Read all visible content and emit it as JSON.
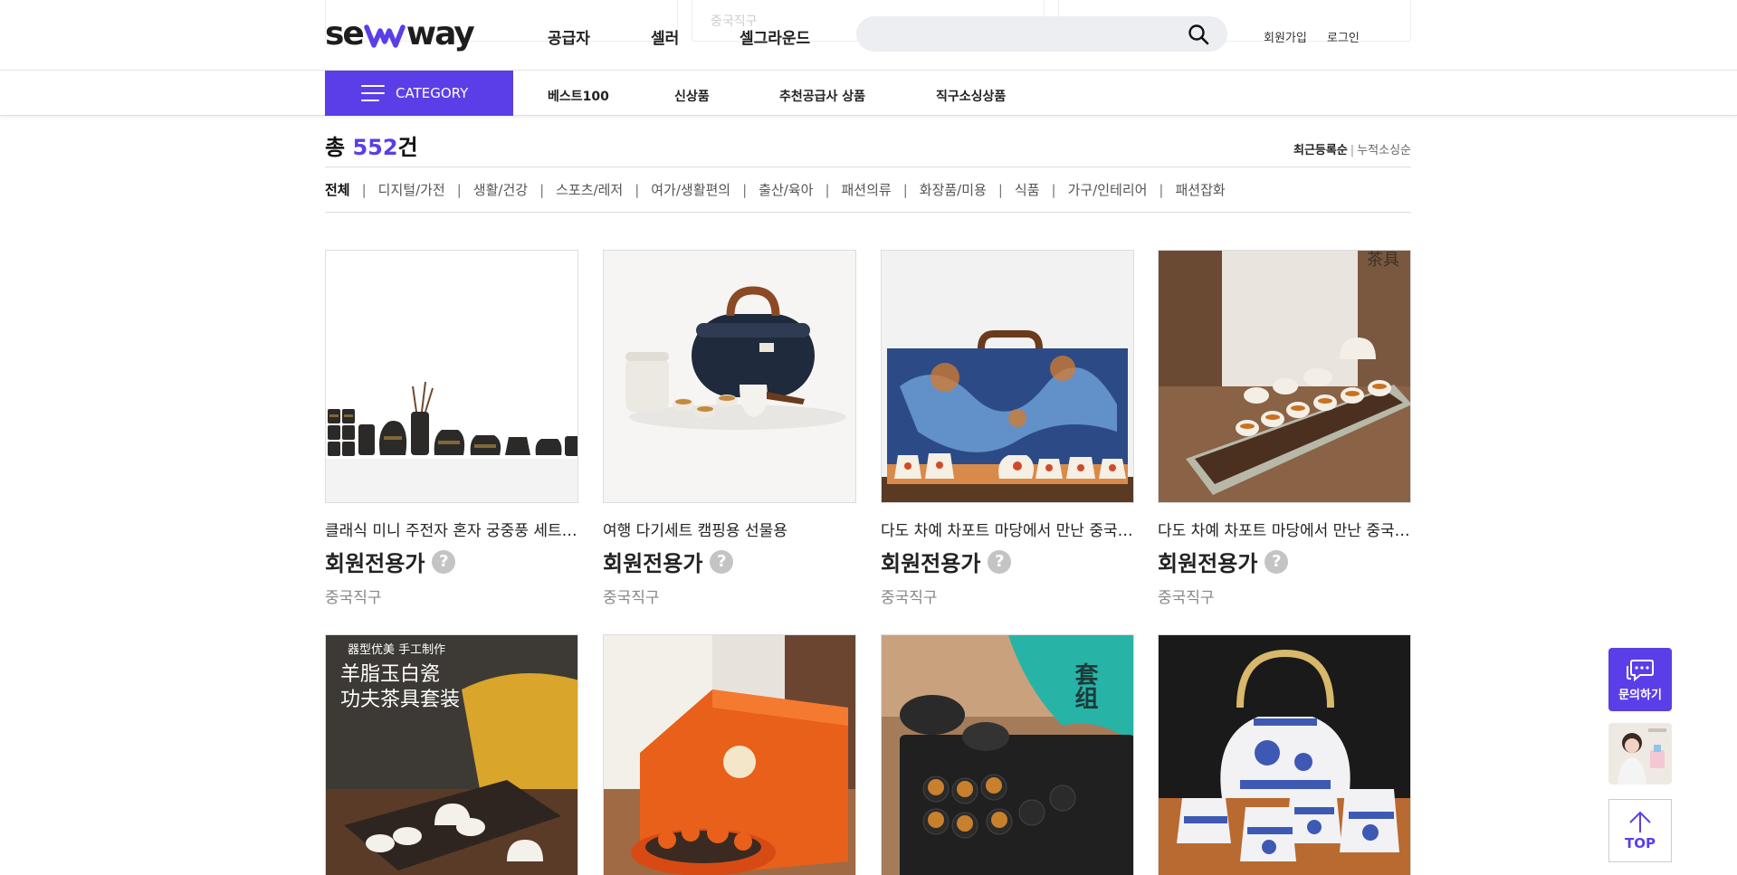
{
  "header": {
    "logo": {
      "pre": "se",
      "post": "way"
    },
    "nav": [
      "공급자",
      "셀러",
      "셀그라운드"
    ],
    "search": {
      "placeholder": ""
    },
    "util": [
      "회원가입",
      "로그인"
    ],
    "ghost_texts": [
      "중국직구"
    ]
  },
  "category_bar": {
    "button_label": "CATEGORY",
    "links": [
      "베스트100",
      "신상품",
      "추천공급사 상품",
      "직구소싱상품"
    ]
  },
  "results": {
    "total_prefix": "총 ",
    "total_count": "552",
    "total_suffix": "건",
    "sort": {
      "active": "최근등록순",
      "other": "누적소싱순"
    },
    "tabs": [
      "전체",
      "디지털/가전",
      "생활/건강",
      "스포츠/레저",
      "여가/생활편의",
      "출산/육아",
      "패션의류",
      "화장품/미용",
      "식품",
      "가구/인테리어",
      "패션잡화"
    ],
    "active_tab": 0
  },
  "products": [
    {
      "name": "클래식 미니 주전자 혼자 궁중풍 세트 가정용",
      "price": "회원전용가",
      "origin": "중국직구"
    },
    {
      "name": "여행 다기세트 캠핑용 선물용",
      "price": "회원전용가",
      "origin": "중국직구"
    },
    {
      "name": "다도 차예 차포트 마당에서 만난 중국식 다기세트",
      "price": "회원전용가",
      "origin": "중국직구"
    },
    {
      "name": "다도 차예 차포트 마당에서 만난 중국식 다기세트",
      "price": "회원전용가",
      "origin": "중국직구"
    },
    {
      "name": "",
      "price": "",
      "origin": ""
    },
    {
      "name": "",
      "price": "",
      "origin": ""
    },
    {
      "name": "",
      "price": "",
      "origin": ""
    },
    {
      "name": "",
      "price": "",
      "origin": ""
    }
  ],
  "image_texts": {
    "p4_corner": "茶具",
    "p5_line1": "器型优美  手工制作",
    "p5_line2": "羊脂玉白瓷",
    "p5_line3": "功夫茶具套装",
    "p7_side": "套组"
  },
  "floating": {
    "contact_label": "문의하기",
    "top_label": "TOP"
  },
  "colors": {
    "accent": "#5b3ee8"
  }
}
